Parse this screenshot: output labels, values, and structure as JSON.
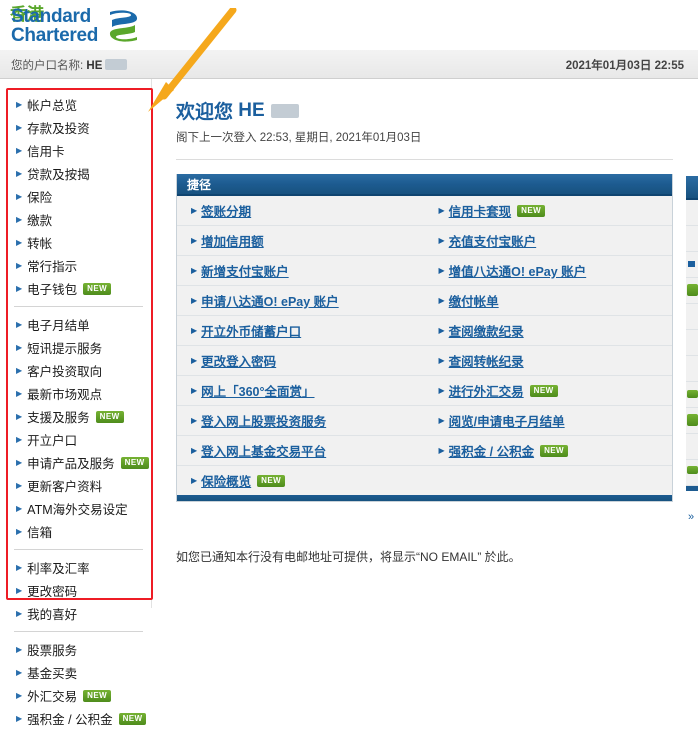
{
  "brand": {
    "name_line1": "Standard",
    "name_line2": "Chartered",
    "region": "香港",
    "logo_blue": "#1b6aab",
    "logo_green": "#5aa72b"
  },
  "account_strip": {
    "account_label": "您的户口名称:",
    "account_value": "HE",
    "datetime": "2021年01月03日 22:55"
  },
  "sidebar": {
    "groups": [
      {
        "items": [
          {
            "label": "帐户总览",
            "new": false
          },
          {
            "label": "存款及投资",
            "new": false
          },
          {
            "label": "信用卡",
            "new": false
          },
          {
            "label": "贷款及按揭",
            "new": false
          },
          {
            "label": "保险",
            "new": false
          },
          {
            "label": "缴款",
            "new": false
          },
          {
            "label": "转帐",
            "new": false
          },
          {
            "label": "常行指示",
            "new": false
          },
          {
            "label": "电子钱包",
            "new": true
          }
        ]
      },
      {
        "items": [
          {
            "label": "电子月结单",
            "new": false
          },
          {
            "label": "短讯提示服务",
            "new": false
          },
          {
            "label": "客户投资取向",
            "new": false
          },
          {
            "label": "最新市场观点",
            "new": false
          },
          {
            "label": "支援及服务",
            "new": true
          },
          {
            "label": "开立户口",
            "new": false
          },
          {
            "label": "申请产品及服务",
            "new": true
          },
          {
            "label": "更新客户资料",
            "new": false
          },
          {
            "label": "ATM海外交易设定",
            "new": false
          },
          {
            "label": "信箱",
            "new": false
          }
        ]
      },
      {
        "items": [
          {
            "label": "利率及汇率",
            "new": false
          },
          {
            "label": "更改密码",
            "new": false
          },
          {
            "label": "我的喜好",
            "new": false
          }
        ]
      },
      {
        "items": [
          {
            "label": "股票服务",
            "new": false
          },
          {
            "label": "基金买卖",
            "new": false
          },
          {
            "label": "外汇交易",
            "new": true
          },
          {
            "label": "强积金 / 公积金",
            "new": true
          }
        ]
      }
    ]
  },
  "main": {
    "welcome_prefix": "欢迎您",
    "welcome_name": "HE",
    "last_login": "阁下上一次登入 22:53, 星期日, 2021年01月03日",
    "note": "如您已通知本行没有电邮地址可提供，将显示“NO EMAIL” 於此。"
  },
  "shortcuts_panel": {
    "title": "捷径",
    "rows": [
      {
        "left": {
          "label": "签账分期",
          "new": false
        },
        "right": {
          "label": "信用卡套现",
          "new": true
        }
      },
      {
        "left": {
          "label": "增加信用额",
          "new": false
        },
        "right": {
          "label": "充值支付宝账户",
          "new": false
        }
      },
      {
        "left": {
          "label": "新增支付宝账户",
          "new": false
        },
        "right": {
          "label": "增值八达通O! ePay 账户",
          "new": false
        }
      },
      {
        "left": {
          "label": "申请八达通O! ePay 账户",
          "new": false
        },
        "right": {
          "label": "缴付帐单",
          "new": false
        }
      },
      {
        "left": {
          "label": "开立外币储蓄户口",
          "new": false
        },
        "right": {
          "label": "查阅缴款纪录",
          "new": false
        }
      },
      {
        "left": {
          "label": "更改登入密码",
          "new": false
        },
        "right": {
          "label": "查阅转帐纪录",
          "new": false
        }
      },
      {
        "left": {
          "label": "网上「360°全面赏」",
          "new": false
        },
        "right": {
          "label": "进行外汇交易",
          "new": true
        }
      },
      {
        "left": {
          "label": "登入网上股票投资服务",
          "new": false
        },
        "right": {
          "label": "阅览/申请电子月结单",
          "new": false
        }
      },
      {
        "left": {
          "label": "登入网上基金交易平台",
          "new": false
        },
        "right": {
          "label": "强积金 / 公积金",
          "new": true
        }
      },
      {
        "left": {
          "label": "保险概览",
          "new": true
        },
        "right": null
      }
    ]
  },
  "badges": {
    "new_label": "NEW",
    "new_color": "#4e8c1c"
  },
  "annotations": {
    "highlight_color": "#ee1c25",
    "arrow_color": "#f5a81c"
  }
}
